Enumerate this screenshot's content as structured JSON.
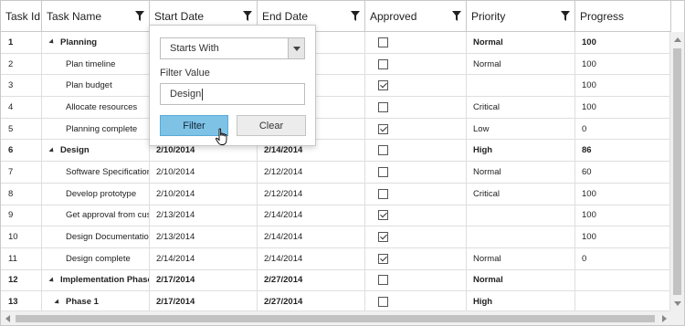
{
  "columns": [
    {
      "label": "Task Id",
      "filterable": false
    },
    {
      "label": "Task Name",
      "filterable": true
    },
    {
      "label": "Start Date",
      "filterable": true
    },
    {
      "label": "End Date",
      "filterable": true
    },
    {
      "label": "Approved",
      "filterable": true
    },
    {
      "label": "Priority",
      "filterable": true
    },
    {
      "label": "Progress",
      "filterable": false
    }
  ],
  "rows": [
    {
      "id": "1",
      "name": "Planning",
      "start": "",
      "end": "",
      "approved": false,
      "priority": "Normal",
      "progress": "100",
      "parent": true,
      "level": 0
    },
    {
      "id": "2",
      "name": "Plan timeline",
      "start": "",
      "end": "",
      "approved": false,
      "priority": "Normal",
      "progress": "100",
      "parent": false,
      "level": 1
    },
    {
      "id": "3",
      "name": "Plan budget",
      "start": "",
      "end": "",
      "approved": true,
      "priority": "",
      "progress": "100",
      "parent": false,
      "level": 1
    },
    {
      "id": "4",
      "name": "Allocate resources",
      "start": "",
      "end": "",
      "approved": false,
      "priority": "Critical",
      "progress": "100",
      "parent": false,
      "level": 1
    },
    {
      "id": "5",
      "name": "Planning complete",
      "start": "",
      "end": "",
      "approved": true,
      "priority": "Low",
      "progress": "0",
      "parent": false,
      "level": 1
    },
    {
      "id": "6",
      "name": "Design",
      "start": "2/10/2014",
      "end": "2/14/2014",
      "approved": false,
      "priority": "High",
      "progress": "86",
      "parent": true,
      "level": 0
    },
    {
      "id": "7",
      "name": "Software Specification",
      "start": "2/10/2014",
      "end": "2/12/2014",
      "approved": false,
      "priority": "Normal",
      "progress": "60",
      "parent": false,
      "level": 1
    },
    {
      "id": "8",
      "name": "Develop prototype",
      "start": "2/10/2014",
      "end": "2/12/2014",
      "approved": false,
      "priority": "Critical",
      "progress": "100",
      "parent": false,
      "level": 1
    },
    {
      "id": "9",
      "name": "Get approval from customer",
      "start": "2/13/2014",
      "end": "2/14/2014",
      "approved": true,
      "priority": "",
      "progress": "100",
      "parent": false,
      "level": 1
    },
    {
      "id": "10",
      "name": "Design Documentation",
      "start": "2/13/2014",
      "end": "2/14/2014",
      "approved": true,
      "priority": "",
      "progress": "100",
      "parent": false,
      "level": 1
    },
    {
      "id": "11",
      "name": "Design complete",
      "start": "2/14/2014",
      "end": "2/14/2014",
      "approved": true,
      "priority": "Normal",
      "progress": "0",
      "parent": false,
      "level": 1
    },
    {
      "id": "12",
      "name": "Implementation Phase",
      "start": "2/17/2014",
      "end": "2/27/2014",
      "approved": false,
      "priority": "Normal",
      "progress": "",
      "parent": true,
      "level": 0
    },
    {
      "id": "13",
      "name": "Phase 1",
      "start": "2/17/2014",
      "end": "2/27/2014",
      "approved": false,
      "priority": "High",
      "progress": "",
      "parent": true,
      "level": 1
    }
  ],
  "filter_popup": {
    "operator": "Starts With",
    "value_label": "Filter Value",
    "value": "Design",
    "filter_button": "Filter",
    "clear_button": "Clear"
  },
  "colors": {
    "accent": "#7ec3e6",
    "border": "#c8c8c8"
  }
}
